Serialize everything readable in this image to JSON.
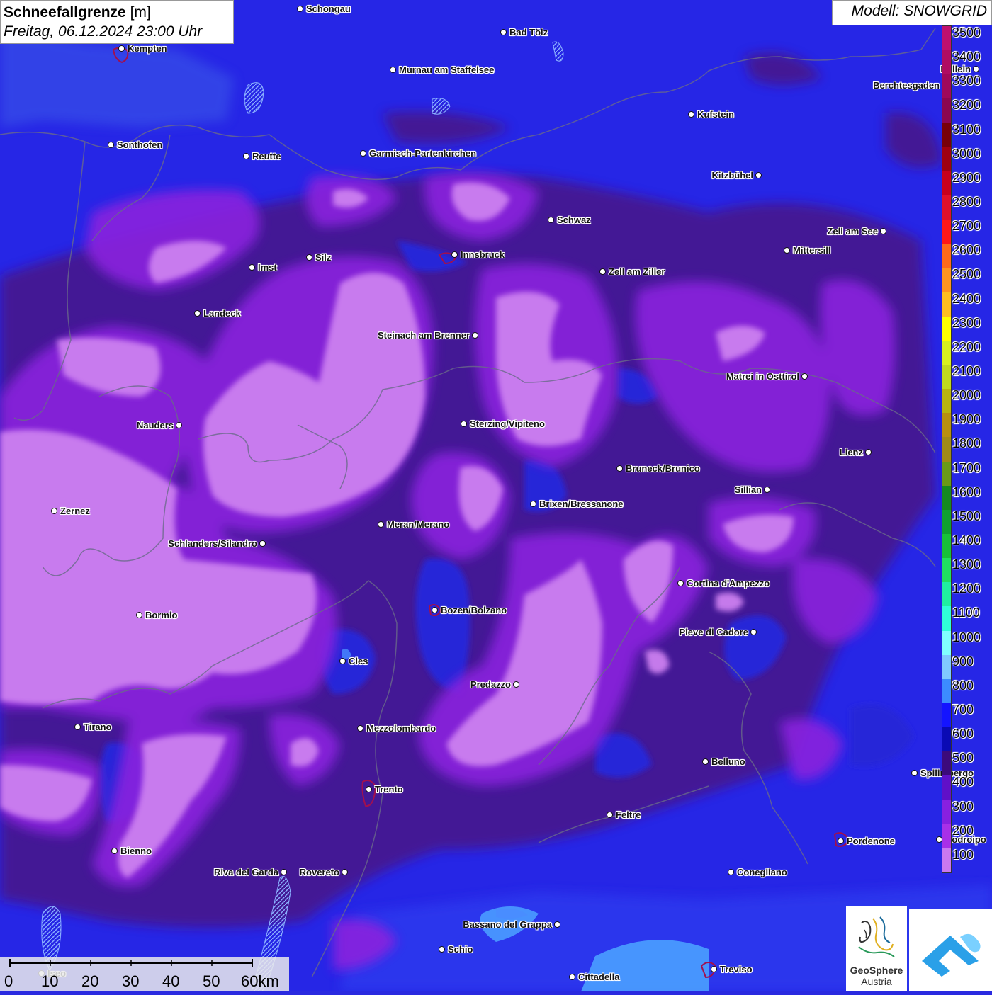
{
  "header": {
    "title": "Schneefallgrenze",
    "unit": "[m]",
    "datetime": "Freitag, 06.12.2024 23:00 Uhr",
    "model": "Modell: SNOWGRID"
  },
  "legend": {
    "levels": [
      {
        "label": "3500",
        "color": "#c0106e"
      },
      {
        "label": "3400",
        "color": "#b00c62"
      },
      {
        "label": "3300",
        "color": "#a0085a"
      },
      {
        "label": "3200",
        "color": "#8c0650"
      },
      {
        "label": "3100",
        "color": "#780008"
      },
      {
        "label": "3000",
        "color": "#a00010"
      },
      {
        "label": "2900",
        "color": "#c8001c"
      },
      {
        "label": "2800",
        "color": "#e0102a"
      },
      {
        "label": "2700",
        "color": "#ff1818"
      },
      {
        "label": "2600",
        "color": "#ff6a1a"
      },
      {
        "label": "2500",
        "color": "#ff9420"
      },
      {
        "label": "2400",
        "color": "#ffbe20"
      },
      {
        "label": "2300",
        "color": "#ffff00"
      },
      {
        "label": "2200",
        "color": "#d8f020"
      },
      {
        "label": "2100",
        "color": "#c0d820"
      },
      {
        "label": "2000",
        "color": "#b8b410"
      },
      {
        "label": "1900",
        "color": "#b89010"
      },
      {
        "label": "1800",
        "color": "#a08a18"
      },
      {
        "label": "1700",
        "color": "#6a9a18"
      },
      {
        "label": "1600",
        "color": "#158a20"
      },
      {
        "label": "1500",
        "color": "#10a030"
      },
      {
        "label": "1400",
        "color": "#18c038"
      },
      {
        "label": "1300",
        "color": "#20e060"
      },
      {
        "label": "1200",
        "color": "#20f0a0"
      },
      {
        "label": "1100",
        "color": "#30ffd8"
      },
      {
        "label": "1000",
        "color": "#80ffff"
      },
      {
        "label": "900",
        "color": "#80c8ff"
      },
      {
        "label": "800",
        "color": "#3c8cff"
      },
      {
        "label": "700",
        "color": "#1414ff"
      },
      {
        "label": "600",
        "color": "#0a0ab4"
      },
      {
        "label": "500",
        "color": "#3c0a7c"
      },
      {
        "label": "400",
        "color": "#6010c8"
      },
      {
        "label": "300",
        "color": "#8820e0"
      },
      {
        "label": "200",
        "color": "#a830e8"
      },
      {
        "label": "100",
        "color": "#c878f0"
      }
    ]
  },
  "cities": [
    {
      "name": "Schongau"
    },
    {
      "name": "Bad Tölz"
    },
    {
      "name": "Kempten"
    },
    {
      "name": "Murnau am Staffelsee"
    },
    {
      "name": "Hallein"
    },
    {
      "name": "Berchtesgaden"
    },
    {
      "name": "Kufstein"
    },
    {
      "name": "Sonthofen"
    },
    {
      "name": "Reutte"
    },
    {
      "name": "Garmisch-Partenkirchen"
    },
    {
      "name": "Kitzbühel"
    },
    {
      "name": "Schwaz"
    },
    {
      "name": "Zell am See"
    },
    {
      "name": "Innsbruck"
    },
    {
      "name": "Mittersill"
    },
    {
      "name": "Silz"
    },
    {
      "name": "Imst"
    },
    {
      "name": "Zell am Ziller"
    },
    {
      "name": "Landeck"
    },
    {
      "name": "Steinach am Brenner"
    },
    {
      "name": "Matrei in Osttirol"
    },
    {
      "name": "Nauders"
    },
    {
      "name": "Sterzing/Vipiteno"
    },
    {
      "name": "Lienz"
    },
    {
      "name": "Bruneck/Brunico"
    },
    {
      "name": "Sillian"
    },
    {
      "name": "Brixen/Bressanone"
    },
    {
      "name": "Zernez"
    },
    {
      "name": "Meran/Merano"
    },
    {
      "name": "Schlanders/Silandro"
    },
    {
      "name": "Cortina d'Ampezzo"
    },
    {
      "name": "Bozen/Bolzano"
    },
    {
      "name": "Bormio"
    },
    {
      "name": "Pieve di Cadore"
    },
    {
      "name": "Cles"
    },
    {
      "name": "Predazzo"
    },
    {
      "name": "Tirano"
    },
    {
      "name": "Mezzolombardo"
    },
    {
      "name": "Belluno"
    },
    {
      "name": "Spilimbergo"
    },
    {
      "name": "Trento"
    },
    {
      "name": "Feltre"
    },
    {
      "name": "Pordenone"
    },
    {
      "name": "Codroipo"
    },
    {
      "name": "Bienno"
    },
    {
      "name": "Riva del Garda"
    },
    {
      "name": "Rovereto"
    },
    {
      "name": "Conegliano"
    },
    {
      "name": "Bassano del Grappa"
    },
    {
      "name": "Schio"
    },
    {
      "name": "Iseo"
    },
    {
      "name": "Cittadella"
    },
    {
      "name": "Treviso"
    }
  ],
  "scale_bar": {
    "labels": [
      "0",
      "10",
      "20",
      "30",
      "40",
      "50",
      "60km"
    ]
  },
  "logos": {
    "geosphere_line1": "GeoSphere",
    "geosphere_line2": "Austria"
  }
}
